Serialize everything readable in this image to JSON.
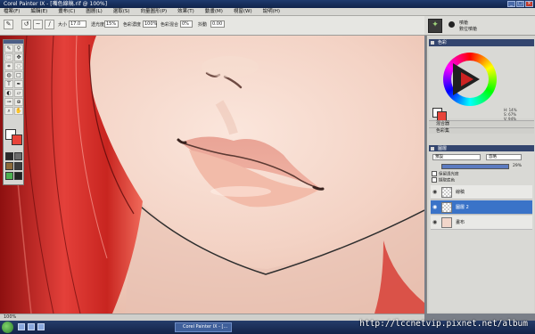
{
  "window": {
    "title": "Corel Painter IX - [嘴色線稿.rif @ 100%]"
  },
  "menu": [
    "檔案(F)",
    "編輯(E)",
    "畫布(C)",
    "圖層(L)",
    "選取(S)",
    "向量圖形(P)",
    "效果(T)",
    "動畫(M)",
    "視窗(W)",
    "說明(H)"
  ],
  "propbar": {
    "size_label": "大小",
    "size_value": "17.0",
    "opacity_label": "透光度",
    "opacity_value": "15%",
    "color_conc_label": "色彩濃度",
    "color_conc_value": "100%",
    "color_mix_label": "色彩混合",
    "color_mix_value": "0%",
    "jitter_label": "抖動",
    "jitter_value": "0.00"
  },
  "brush": {
    "category": "噴槍",
    "variant": "數位噴槍"
  },
  "panels": {
    "colors_title": "色彩",
    "hsv": [
      "H: 14%",
      "S: 67%",
      "V: 94%"
    ],
    "mixer_title": "混合器",
    "color_sets_title": "色彩集",
    "layers_title": "圖層",
    "composite_method": "預設",
    "composite_depth": "忽略",
    "opacity_value": "29%",
    "preserve_label": "保留透光度",
    "pick_underlying_label": "擷取底色",
    "layers": [
      {
        "name": "線稿",
        "selected": false
      },
      {
        "name": "圖層 2",
        "selected": true
      },
      {
        "name": "畫布",
        "selected": false
      }
    ]
  },
  "status": {
    "zoom": "100%"
  },
  "taskbar": {
    "task_label": "Corel Painter IX - [..."
  },
  "watermark": "http://lccnetvip.pixnet.net/album"
}
